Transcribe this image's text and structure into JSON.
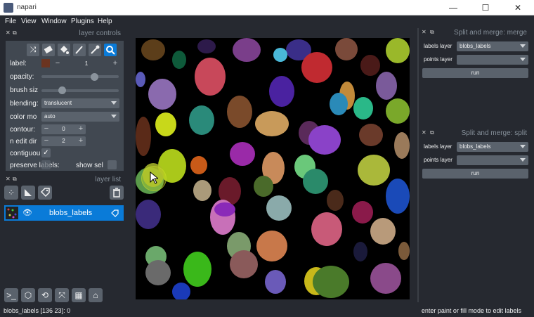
{
  "window": {
    "title": "napari",
    "minimize": "—",
    "maximize": "☐",
    "close": "✕"
  },
  "menu": [
    "File",
    "View",
    "Window",
    "Plugins",
    "Help"
  ],
  "layer_controls": {
    "title": "layer controls",
    "label_row": {
      "label": "label:",
      "value": "1",
      "minus": "−",
      "plus": "+"
    },
    "opacity": {
      "label": "opacity:",
      "value": 0.85
    },
    "brush_size": {
      "label": "brush siz",
      "value": 0.2
    },
    "blending": {
      "label": "blending:",
      "value": "translucent"
    },
    "color_mode": {
      "label": "color mo",
      "value": "auto"
    },
    "contour": {
      "label": "contour:",
      "value": "0"
    },
    "n_edit_dim": {
      "label": "n edit dir",
      "value": "2"
    },
    "contiguous": {
      "label": "contiguou",
      "checked": "✓"
    },
    "preserve_labels": {
      "label": "preserve labels:"
    },
    "show_selected": {
      "label": "show sel"
    },
    "tools": [
      "shuffle-icon",
      "erase-icon",
      "fill-icon",
      "paint-icon",
      "picker-icon",
      "zoom-icon"
    ]
  },
  "layer_list": {
    "title": "layer list",
    "layers": [
      {
        "name": "blobs_labels",
        "visible": true
      }
    ]
  },
  "split_merge_1": {
    "title": "Split and merge: merge",
    "labels_layer_label": "labels layer",
    "labels_layer_value": "blobs_labels",
    "points_layer_label": "points layer",
    "points_layer_value": "",
    "run": "run"
  },
  "split_merge_2": {
    "title": "Split and merge: split",
    "labels_layer_label": "labels layer",
    "labels_layer_value": "blobs_labels",
    "points_layer_label": "points layer",
    "points_layer_value": "",
    "run": "run"
  },
  "status": {
    "left": "blobs_labels [136  23]: 0",
    "right": "enter paint or fill mode to edit labels"
  }
}
